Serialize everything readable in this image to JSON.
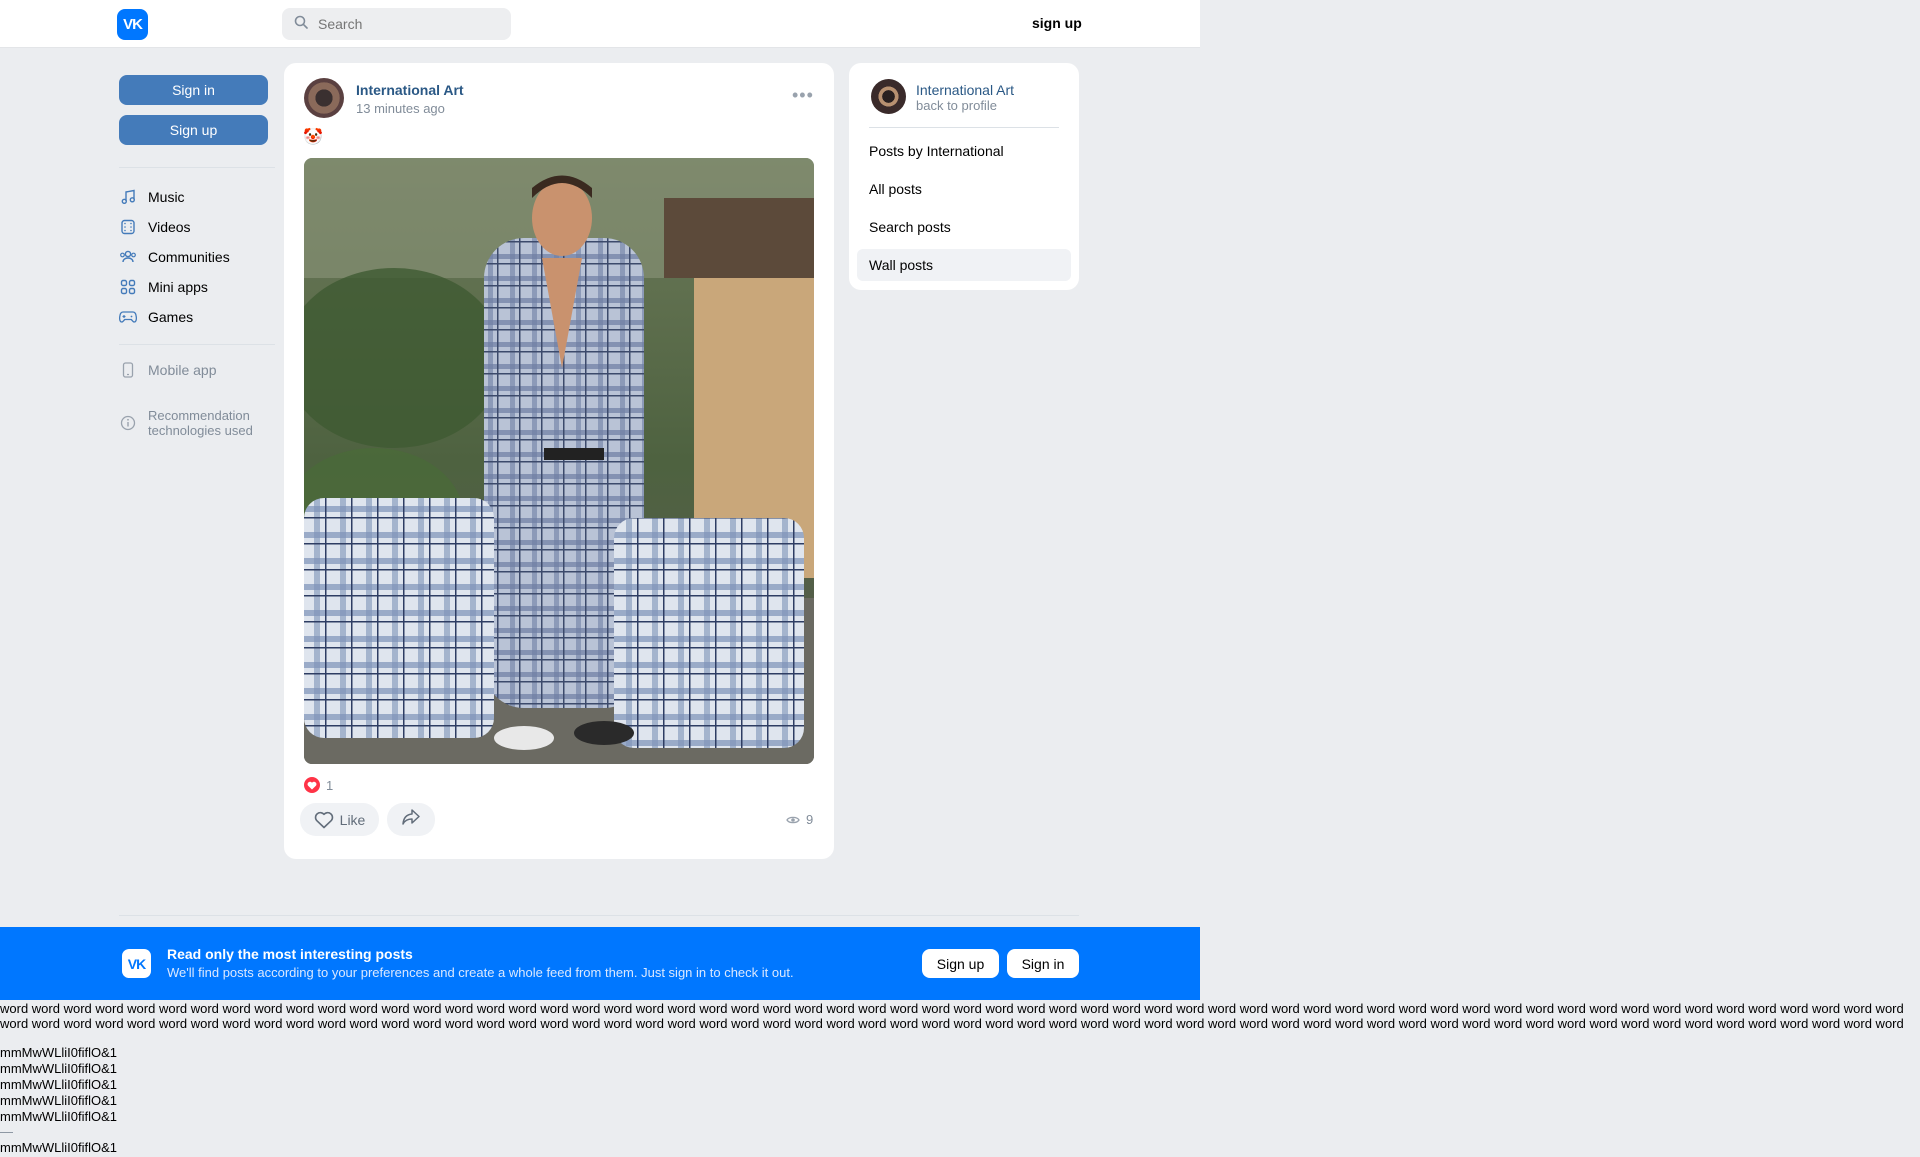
{
  "header": {
    "logo_text": "VK",
    "search_placeholder": "Search",
    "signup_label": "sign up"
  },
  "sidebar": {
    "sign_in_label": "Sign in",
    "sign_up_label": "Sign up",
    "items": [
      {
        "label": "Music",
        "icon": "music-note-icon"
      },
      {
        "label": "Videos",
        "icon": "video-film-icon"
      },
      {
        "label": "Communities",
        "icon": "people-icon"
      },
      {
        "label": "Mini apps",
        "icon": "grid-apps-icon"
      },
      {
        "label": "Games",
        "icon": "gamepad-icon"
      }
    ],
    "secondary": [
      {
        "label": "Mobile app",
        "icon": "phone-icon"
      },
      {
        "label": "Recommendation technologies used",
        "icon": "info-icon"
      }
    ]
  },
  "post": {
    "author": "International Art",
    "time": "13 minutes ago",
    "emoji": "🤡",
    "like_count": "1",
    "like_label": "Like",
    "views_count": "9"
  },
  "right_panel": {
    "name": "International Art",
    "back_label": "back to profile",
    "items": [
      {
        "label": "Posts by International",
        "active": false
      },
      {
        "label": "All posts",
        "active": false
      },
      {
        "label": "Search posts",
        "active": false
      },
      {
        "label": "Wall posts",
        "active": true
      }
    ]
  },
  "banner": {
    "logo_text": "VK",
    "title": "Read only the most interesting posts",
    "subtitle": "We'll find posts according to your preferences and create a whole feed from them. Just sign in to check it out.",
    "sign_up_label": "Sign up",
    "sign_in_label": "Sign in"
  },
  "test_text": {
    "words": "word word word word word word word word word word word word word word word word word word word word word word word word word word word word word word word word word word word word word word word word word word word word word word word word word word word word word word word word word word word word word word word word word word word word word word word word word word word word word word word word word word word word word word word word word word word word word word word word word word word word word word word word word word word word word word word word word word word word word word word word word word word word word word word word word word word word word word word word word word word word word word word word",
    "glyph_lines": [
      "mmMwWLliI0fiflO&1",
      "mmMwWLliI0fiflO&1",
      "mmMwWLliI0fiflO&1",
      "mmMwWLliI0fiflO&1",
      "mmMwWLliI0fiflO&1"
    ],
    "separator": "—",
    "glyph_last": "mmMwWLliI0fiflO&1"
  },
  "colors": {
    "accent": "#0077ff",
    "button_blue": "#447bba",
    "link": "#2a5885",
    "background": "#ebedf0"
  }
}
